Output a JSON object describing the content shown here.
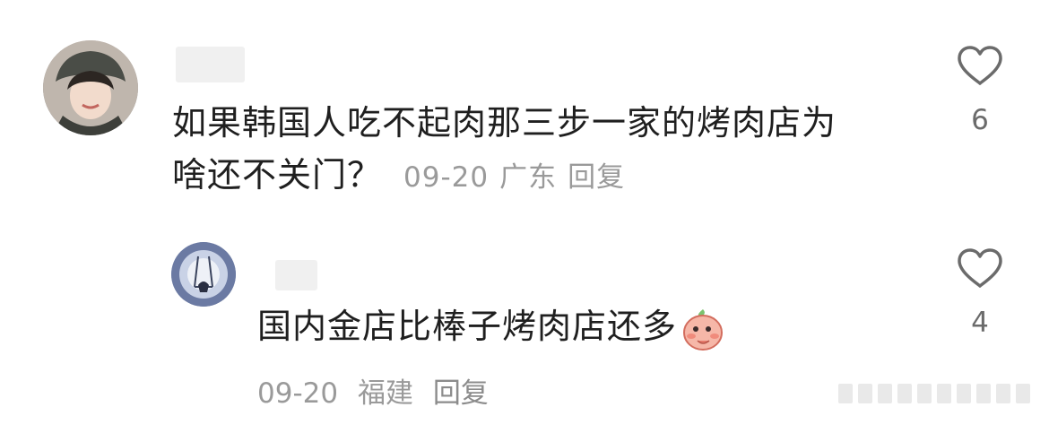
{
  "comments": [
    {
      "text_line1": "如果韩国人吃不起肉那三步一家的烤肉店为",
      "text_line2": "啥还不关门？",
      "date": "09-20",
      "location": "广东",
      "reply_label": "回复",
      "likes": "6",
      "icons": [
        "avatar",
        "heart-icon"
      ]
    },
    {
      "text": "国内金店比棒子烤肉店还多",
      "emoji": "peach-blush-emoji",
      "date": "09-20",
      "location": "福建",
      "reply_label": "回复",
      "likes": "4",
      "icons": [
        "avatar",
        "heart-icon"
      ]
    }
  ]
}
